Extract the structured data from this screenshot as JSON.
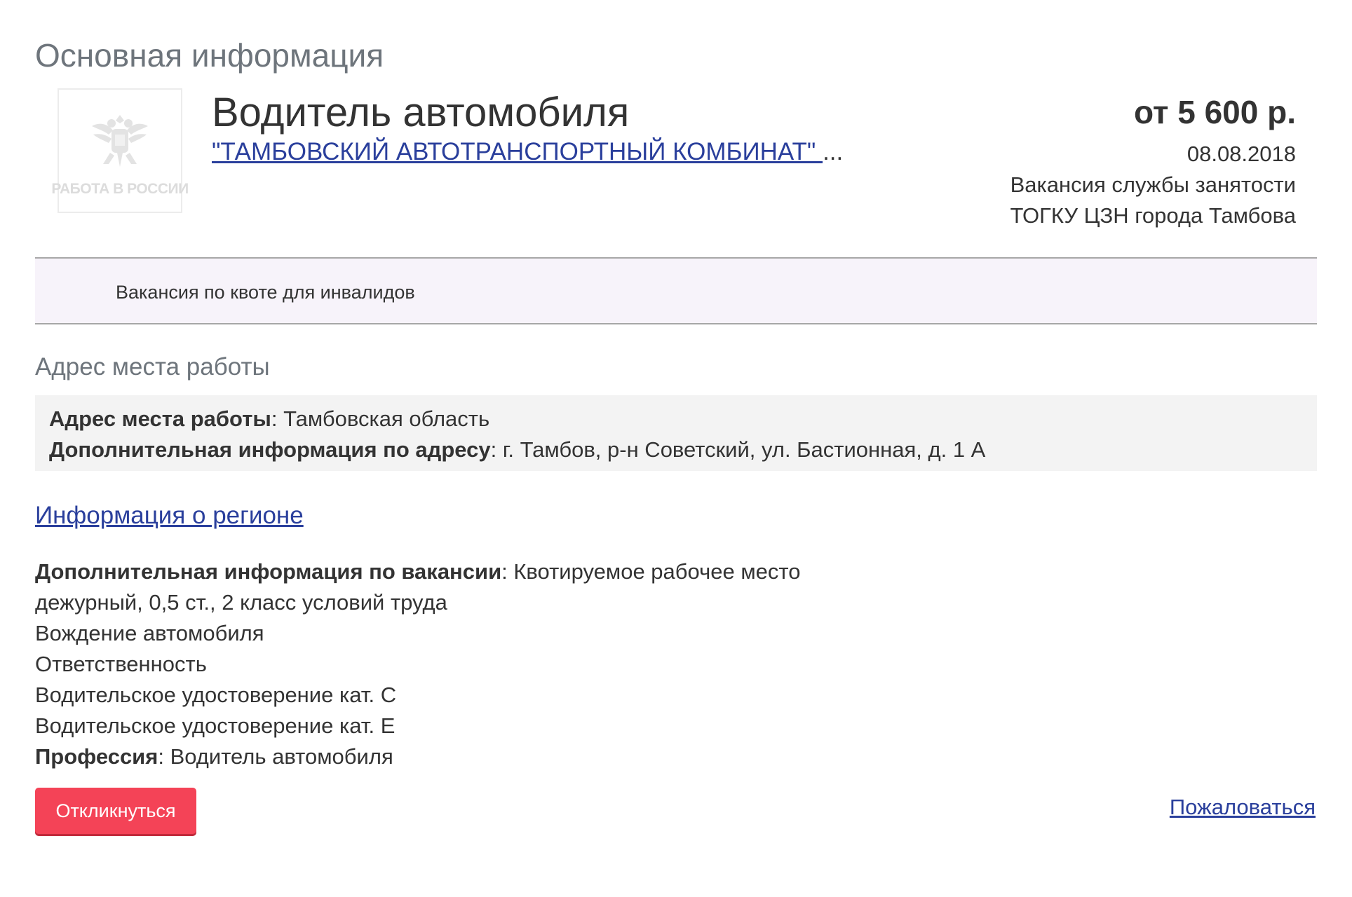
{
  "section": {
    "title": "Основная информация"
  },
  "logo": {
    "caption": "РАБОТА В РОССИИ",
    "icon": "double-headed-eagle-emblem"
  },
  "vacancy": {
    "title": "Водитель автомобиля",
    "employer": "\"ТАМБОВСКИЙ АВТОТРАНСПОРТНЫЙ КОМБИНАТ\" ",
    "employer_ellipsis": "...",
    "salary": "от 5 600 р.",
    "date": "08.08.2018",
    "source": "Вакансия службы занятости",
    "agency": "ТОГКУ ЦЗН города Тамбова"
  },
  "quota": {
    "text": "Вакансия по квоте для инвалидов"
  },
  "address": {
    "heading": "Адрес места работы",
    "workplace_label": "Адрес места работы",
    "workplace_value": ": Тамбовская область",
    "extra_label": "Дополнительная информация по адресу",
    "extra_value": ": г. Тамбов, р-н Советский, ул. Бастионная, д. 1 А"
  },
  "region_link": "Информация о регионе",
  "details": {
    "extra_label": "Дополнительная информация по вакансии",
    "extra_value": ": Квотируемое рабочее место",
    "lines": [
      "дежурный, 0,5 ст., 2 класс условий труда",
      "Вождение автомобиля",
      "Ответственность",
      "Водительское удостоверение кат. С",
      "Водительское удостоверение кат. Е"
    ],
    "profession_label": "Профессия",
    "profession_value": ": Водитель автомобиля"
  },
  "actions": {
    "respond": "Откликнуться",
    "complain": "Пожаловаться"
  },
  "colors": {
    "link": "#2a3f9c",
    "button": "#f44357",
    "quota_band": "#f7f3fa",
    "address_box": "#f3f3f3"
  }
}
